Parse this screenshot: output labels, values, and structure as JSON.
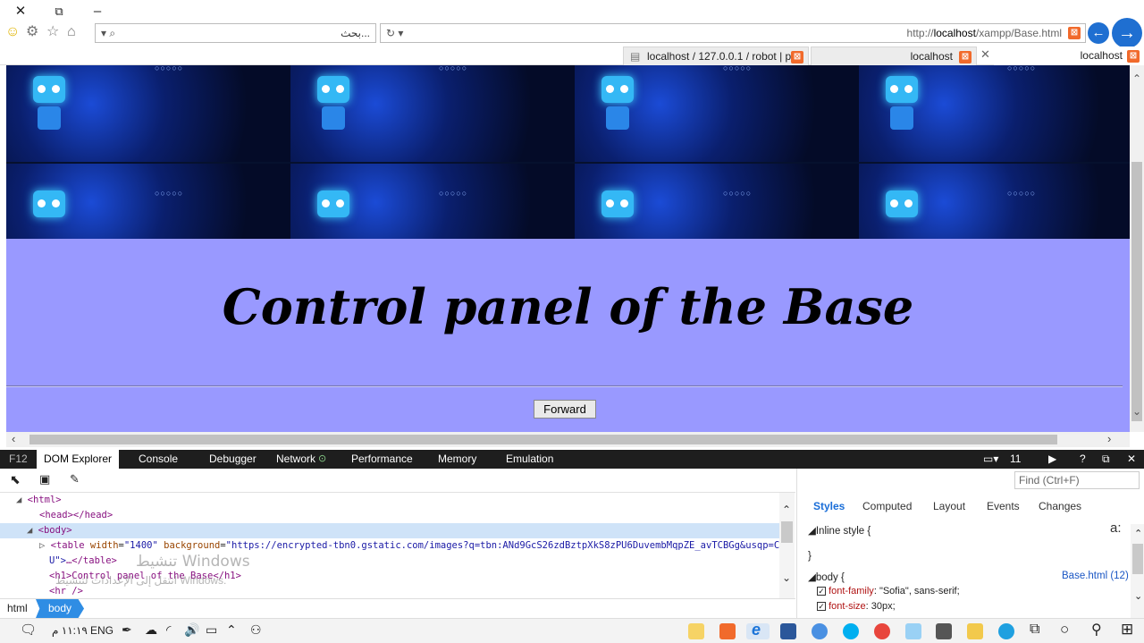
{
  "browser": {
    "search_placeholder": "بحث...",
    "url_prefix": "http://",
    "url_host": "localhost",
    "url_path": "/xampp/Base.html",
    "tabs": [
      {
        "label": "localhost / 127.0.0.1 / robot | p..."
      },
      {
        "label": "localhost"
      },
      {
        "label": "localhost"
      }
    ]
  },
  "page": {
    "title": "Control panel of the Base",
    "forward_button": "Forward",
    "background_color": "#9999ff"
  },
  "devtools": {
    "f12": "F12",
    "tabs": [
      "DOM Explorer",
      "Console",
      "Debugger",
      "Network",
      "Performance",
      "Memory",
      "Emulation"
    ],
    "document_mode": "11",
    "find_placeholder": "Find (Ctrl+F)",
    "dom_lines": {
      "html": "<html>",
      "head": "<head></head>",
      "body": "<body>",
      "table_open_tag": "<table",
      "table_width_attr": "width",
      "table_width_val": "\"1400\"",
      "table_bg_attr": "background",
      "table_bg_val": "\"https://encrypted-tbn0.gstatic.com/images?q=tbn:ANd9GcS26zdBztpXkS8zPU6DuvembMqpZE_avTCBGg&usqp=CA",
      "table_bg_val_cont": "U\">",
      "table_close": "…</table>",
      "h1": "<h1>Control panel of the Base</h1>",
      "hr": "<hr />"
    },
    "breadcrumbs": [
      "html",
      "body"
    ],
    "styles_tabs": [
      "Styles",
      "Computed",
      "Layout",
      "Events",
      "Changes"
    ],
    "inline_style": "Inline style  {",
    "inline_close": "}",
    "rule_selector": "body  {",
    "rule_source": "Base.html (12)",
    "prop1_name": "font-family",
    "prop1_value": "\"Sofia\", sans-serif;",
    "prop2_name": "font-size",
    "prop2_value": "30px;",
    "aa": "a:",
    "watermark_title": "تنشيط Windows",
    "watermark_sub": "انتقل إلى الإعدادات لتنشيط Windows."
  },
  "taskbar": {
    "time": "١١:١٩ م",
    "lang": "ENG"
  }
}
